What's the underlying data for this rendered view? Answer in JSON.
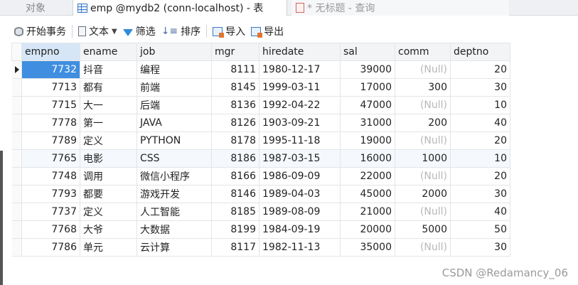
{
  "tabs": [
    {
      "label": "对象"
    },
    {
      "label": "emp @mydb2 (conn-localhost) - 表"
    },
    {
      "label": "* 无标题 - 查询"
    }
  ],
  "toolbar": {
    "begin_transaction": "开始事务",
    "text": "文本",
    "filter": "筛选",
    "sort": "排序",
    "import": "导入",
    "export": "导出"
  },
  "grid": {
    "columns": [
      "empno",
      "ename",
      "job",
      "mgr",
      "hiredate",
      "sal",
      "comm",
      "deptno"
    ],
    "rows": [
      [
        "7732",
        "抖音",
        "编程",
        "8111",
        "1980-12-17",
        "39000",
        "(Null)",
        "20"
      ],
      [
        "7713",
        "都有",
        "前端",
        "8145",
        "1999-03-11",
        "17000",
        "300",
        "30"
      ],
      [
        "7715",
        "大一",
        "后端",
        "8136",
        "1992-04-22",
        "47000",
        "(Null)",
        "10"
      ],
      [
        "7778",
        "第一",
        "JAVA",
        "8126",
        "1903-09-21",
        "31000",
        "200",
        "40"
      ],
      [
        "7789",
        "定义",
        "PYTHON",
        "8178",
        "1995-11-18",
        "19000",
        "(Null)",
        "20"
      ],
      [
        "7765",
        "电影",
        "CSS",
        "8186",
        "1987-03-15",
        "16000",
        "1000",
        "10"
      ],
      [
        "7748",
        "调用",
        "微信小程序",
        "8166",
        "1986-09-09",
        "22000",
        "(Null)",
        "20"
      ],
      [
        "7793",
        "都要",
        "游戏开发",
        "8146",
        "1989-04-03",
        "45000",
        "2000",
        "30"
      ],
      [
        "7737",
        "定义",
        "人工智能",
        "8185",
        "1989-08-09",
        "21000",
        "(Null)",
        "40"
      ],
      [
        "7768",
        "大爷",
        "大数据",
        "8199",
        "1984-09-19",
        "20000",
        "5000",
        "50"
      ],
      [
        "7786",
        "单元",
        "云计算",
        "8117",
        "1982-11-13",
        "35000",
        "(Null)",
        "30"
      ]
    ]
  },
  "watermark": "CSDN @Redamancy_06"
}
